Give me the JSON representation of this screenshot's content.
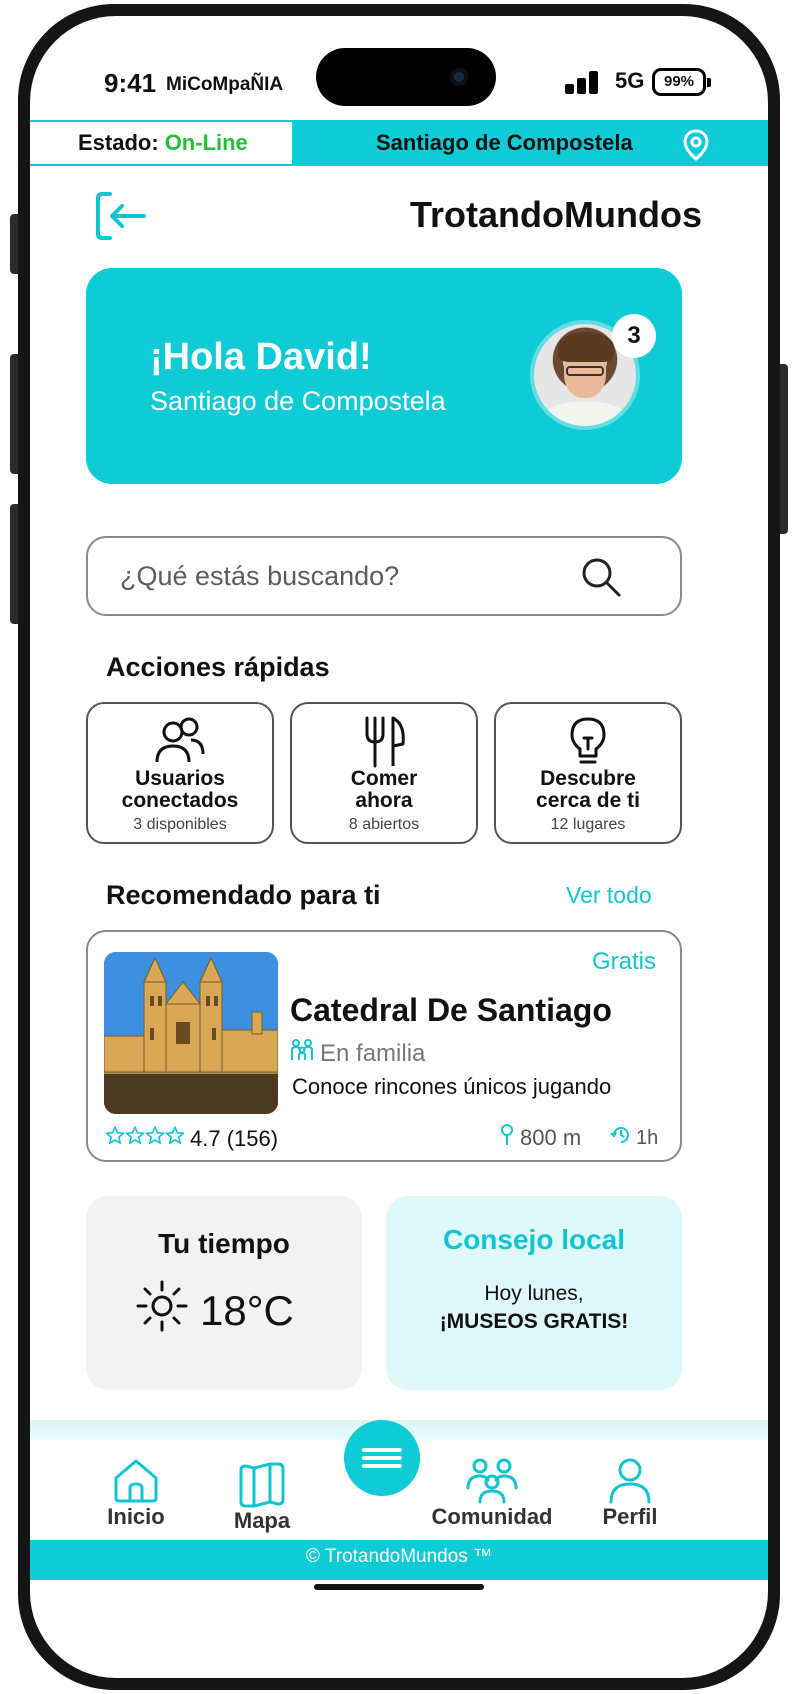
{
  "status_bar": {
    "time": "9:41",
    "carrier": "MiCoMpaÑIA",
    "network": "5G",
    "battery": "99%"
  },
  "info_bar": {
    "state_label": "Estado:",
    "state_value": "On-Line",
    "city": "Santiago de Compostela"
  },
  "header": {
    "app_title": "TrotandoMundos"
  },
  "hero": {
    "greeting": "¡Hola David!",
    "location": "Santiago de Compostela",
    "notifications": "3"
  },
  "search": {
    "placeholder": "¿Qué estás buscando?"
  },
  "quick_actions": {
    "title": "Acciones rápidas",
    "items": [
      {
        "label": "Usuarios conectados",
        "count": "3 disponibles",
        "icon": "users-icon"
      },
      {
        "label": "Comer ahora",
        "count": "8 abiertos",
        "icon": "cutlery-icon"
      },
      {
        "label": "Descubre cerca de ti",
        "count": "12 lugares",
        "icon": "lightbulb-icon"
      }
    ]
  },
  "recommended": {
    "title": "Recomendado para ti",
    "see_all": "Ver todo",
    "card": {
      "price": "Gratis",
      "name": "Catedral De Santiago",
      "tag": "En familia",
      "description": "Conoce rincones únicos jugando",
      "rating": "4.7 (156)",
      "stars": 4,
      "distance": "800 m",
      "duration": "1h"
    }
  },
  "weather": {
    "title": "Tu tiempo",
    "value": "18°C",
    "icon": "sun-icon"
  },
  "tip": {
    "title": "Consejo local",
    "line1": "Hoy lunes,",
    "line2": "¡MUSEOS GRATIS!"
  },
  "nav": {
    "items": [
      {
        "label": "Inicio",
        "icon": "home-icon"
      },
      {
        "label": "Mapa",
        "icon": "map-icon"
      },
      {
        "label": "Comunidad",
        "icon": "community-icon"
      },
      {
        "label": "Perfil",
        "icon": "profile-icon"
      }
    ]
  },
  "footer": {
    "text": "© TrotandoMundos ™"
  },
  "colors": {
    "accent": "#0fcbd6",
    "online": "#22c03a",
    "tip_bg": "#dff8fa"
  }
}
